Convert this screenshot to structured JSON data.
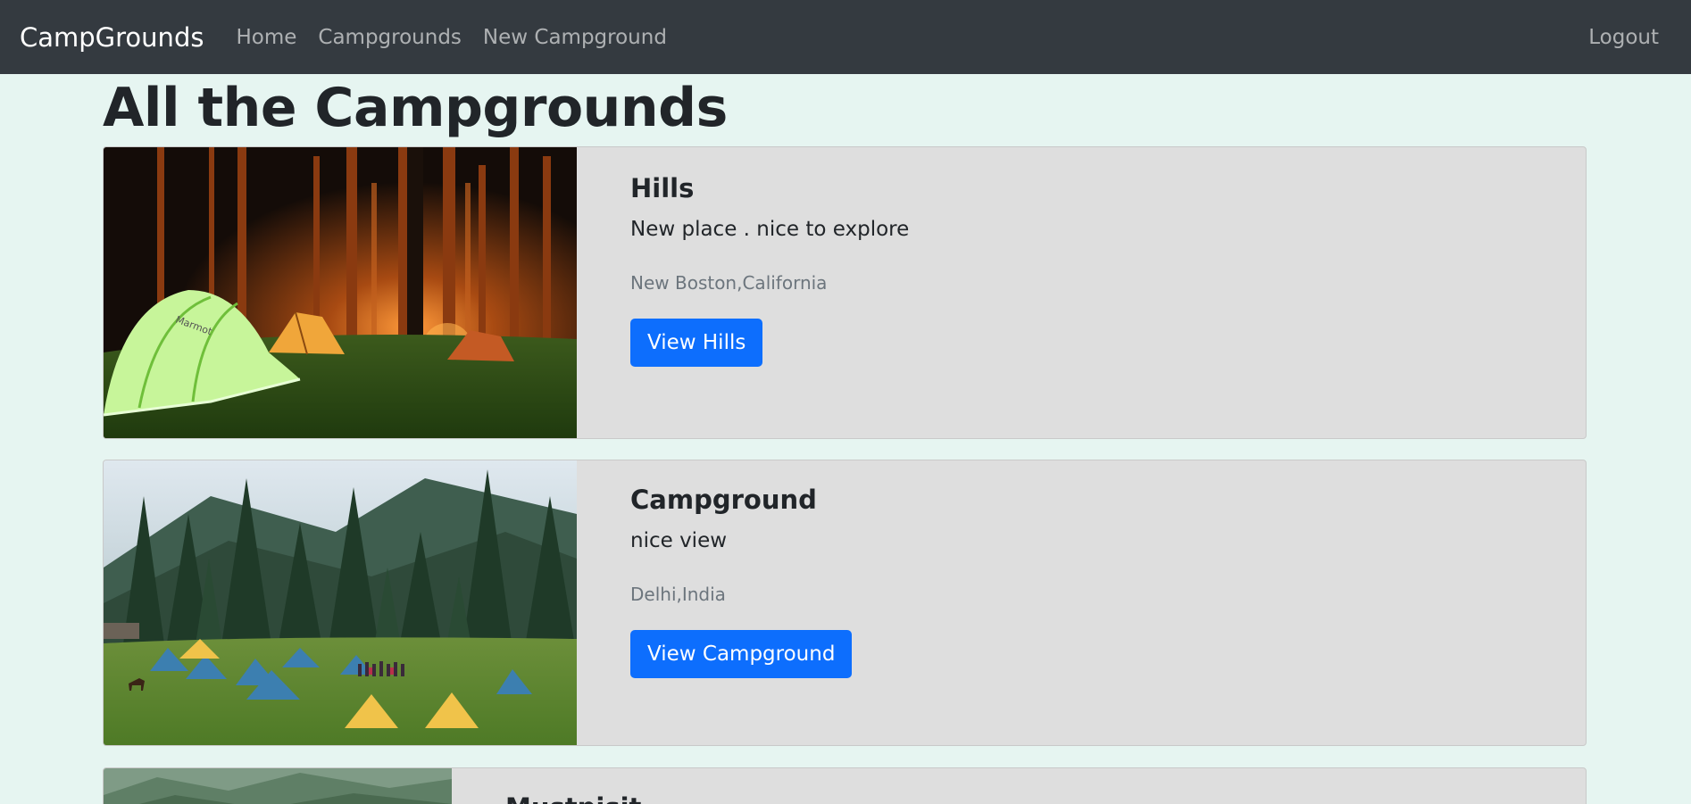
{
  "navbar": {
    "brand": "CampGrounds",
    "links": [
      "Home",
      "Campgrounds",
      "New Campground"
    ],
    "logout": "Logout"
  },
  "page": {
    "title": "All the Campgrounds"
  },
  "campgrounds": [
    {
      "title": "Hills",
      "description": "New place . nice to explore",
      "location": "New Boston,California",
      "button": "View Hills",
      "image": "night-forest-tents-image"
    },
    {
      "title": "Campground",
      "description": "nice view",
      "location": "Delhi,India",
      "button": "View Campground",
      "image": "meadow-tents-image"
    },
    {
      "title": "Mustpisit",
      "image": "mountain-forest-image"
    }
  ],
  "colors": {
    "navbar_bg": "#343a40",
    "page_bg": "#e6f5f1",
    "card_bg": "#dedede",
    "button_bg": "#0d6efd"
  }
}
